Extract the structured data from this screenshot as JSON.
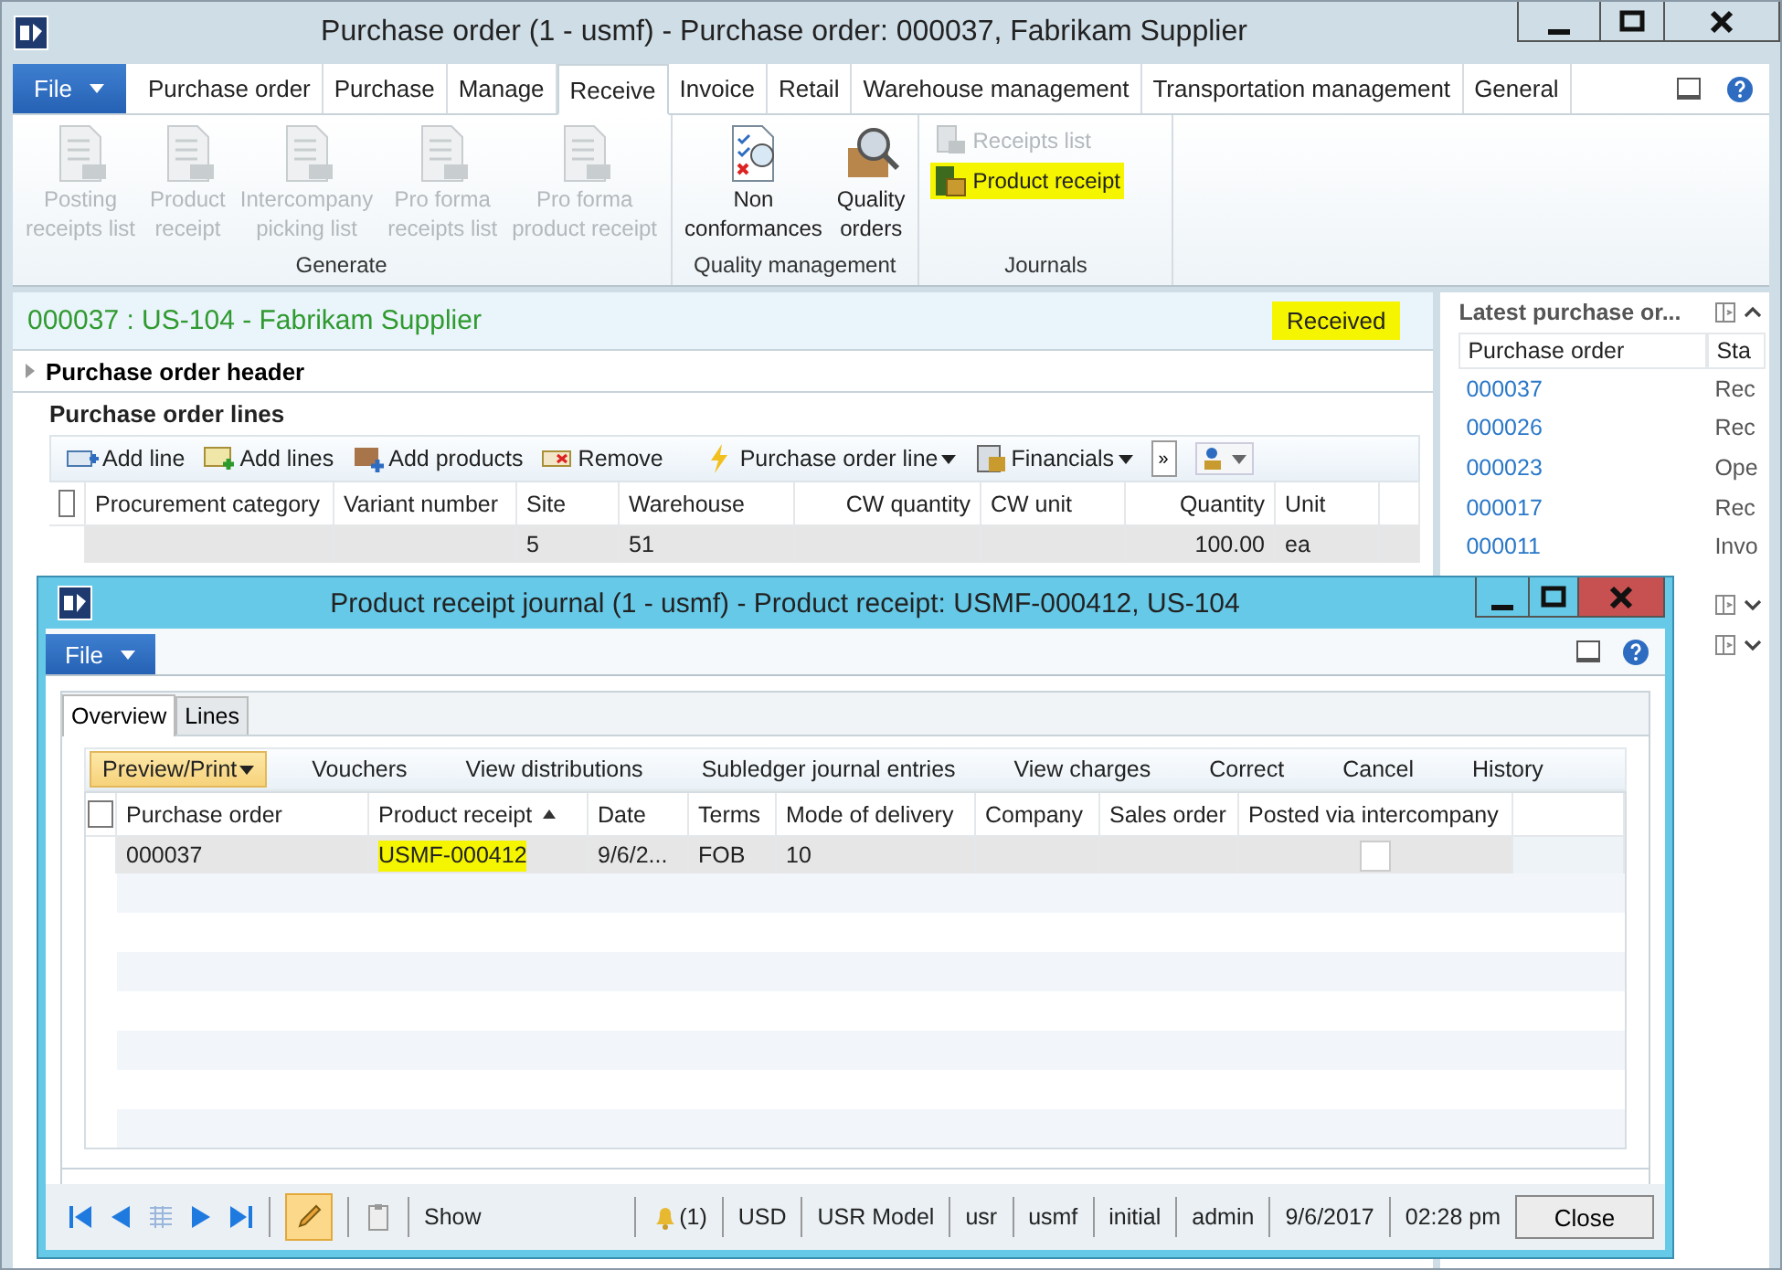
{
  "main_window": {
    "title": "Purchase order (1 - usmf) - Purchase order: 000037, Fabrikam Supplier",
    "file_menu": "File",
    "tabs": [
      {
        "label": "Purchase order",
        "selected": false
      },
      {
        "label": "Purchase",
        "selected": false
      },
      {
        "label": "Manage",
        "selected": false
      },
      {
        "label": "Receive",
        "selected": true
      },
      {
        "label": "Invoice",
        "selected": false
      },
      {
        "label": "Retail",
        "selected": false
      },
      {
        "label": "Warehouse management",
        "selected": false
      },
      {
        "label": "Transportation management",
        "selected": false
      },
      {
        "label": "General",
        "selected": false
      }
    ],
    "ribbon_groups": [
      {
        "title": "Generate",
        "kind": "large",
        "buttons": [
          {
            "label": "Posting\nreceipts list",
            "disabled": true,
            "highlighted": false
          },
          {
            "label": "Product\nreceipt",
            "disabled": true,
            "highlighted": false
          },
          {
            "label": "Intercompany\npicking list",
            "disabled": true,
            "highlighted": false
          },
          {
            "label": "Pro forma\nreceipts list",
            "disabled": true,
            "highlighted": false
          },
          {
            "label": "Pro forma\nproduct receipt",
            "disabled": true,
            "highlighted": false
          }
        ]
      },
      {
        "title": "Quality management",
        "kind": "large",
        "buttons": [
          {
            "label": "Non\nconformances",
            "disabled": false,
            "highlighted": false
          },
          {
            "label": "Quality\norders",
            "disabled": false,
            "highlighted": false
          }
        ]
      },
      {
        "title": "Journals",
        "kind": "small",
        "buttons": [
          {
            "label": "Receipts list",
            "disabled": true,
            "highlighted": false
          },
          {
            "label": "Product receipt",
            "disabled": false,
            "highlighted": true
          }
        ]
      }
    ],
    "header": {
      "title": "000037 : US-104 - Fabrikam Supplier",
      "status": "Received",
      "status_highlighted": true
    },
    "sections": [
      {
        "title": "Purchase order header",
        "expanded": false
      },
      {
        "title": "Purchase order lines",
        "expanded": true
      }
    ],
    "lines_toolbar": [
      {
        "label": "Add line",
        "menu": false
      },
      {
        "label": "Add lines",
        "menu": false
      },
      {
        "label": "Add products",
        "menu": false
      },
      {
        "label": "Remove",
        "menu": false
      },
      {
        "label": "Purchase order line",
        "menu": true
      },
      {
        "label": "Financials",
        "menu": true
      }
    ],
    "more_button": "»",
    "lines_table": {
      "all_selected": false,
      "columns": [
        "Procurement category",
        "Variant number",
        "Site",
        "Warehouse",
        "CW quantity",
        "CW unit",
        "Quantity",
        "Unit"
      ],
      "rows": [
        {
          "cells": [
            "",
            "",
            "5",
            "51",
            "",
            "",
            "100.00",
            "ea"
          ]
        }
      ]
    },
    "factbox": {
      "title": "Latest purchase or...",
      "expanded": true,
      "columns": [
        "Purchase order",
        "Sta"
      ],
      "rows": [
        [
          "000037",
          "Rec"
        ],
        [
          "000026",
          "Rec"
        ],
        [
          "000023",
          "Ope"
        ],
        [
          "000017",
          "Rec"
        ],
        [
          "000011",
          "Invo"
        ]
      ]
    }
  },
  "dialog": {
    "title": "Product receipt journal (1 - usmf) - Product receipt: USMF-000412, US-104",
    "file_menu": "File",
    "tabs": [
      {
        "label": "Overview",
        "selected": true
      },
      {
        "label": "Lines",
        "selected": false
      }
    ],
    "toolbar": [
      {
        "label": "Preview/Print",
        "menu": true,
        "active": true
      },
      {
        "label": "Vouchers",
        "menu": false,
        "active": false
      },
      {
        "label": "View distributions",
        "menu": false,
        "active": false
      },
      {
        "label": "Subledger journal entries",
        "menu": false,
        "active": false
      },
      {
        "label": "View charges",
        "menu": false,
        "active": false
      },
      {
        "label": "Correct",
        "menu": false,
        "active": false
      },
      {
        "label": "Cancel",
        "menu": false,
        "active": false
      },
      {
        "label": "History",
        "menu": false,
        "active": false
      }
    ],
    "table": {
      "all_selected": false,
      "columns": [
        {
          "label": "Purchase order",
          "sorted": false
        },
        {
          "label": "Product receipt",
          "sorted": true
        },
        {
          "label": "Date",
          "sorted": false
        },
        {
          "label": "Terms",
          "sorted": false
        },
        {
          "label": "Mode of delivery",
          "sorted": false
        },
        {
          "label": "Company",
          "sorted": false
        },
        {
          "label": "Sales order",
          "sorted": false
        },
        {
          "label": "Posted via intercompany",
          "sorted": false
        }
      ],
      "rows": [
        {
          "cells": [
            {
              "text": "000037",
              "highlighted": false
            },
            {
              "text": "USMF-000412",
              "highlighted": true
            },
            {
              "text": "9/6/2...",
              "highlighted": false
            },
            {
              "text": "FOB",
              "highlighted": false
            },
            {
              "text": "10",
              "highlighted": false
            },
            {
              "text": "",
              "highlighted": false
            },
            {
              "text": "",
              "highlighted": false
            }
          ],
          "posted_via_intercompany": false
        }
      ]
    },
    "status_bar": {
      "edit_mode": true,
      "show": "Show",
      "notifications": "(1)",
      "fields": [
        "USD",
        "USR Model",
        "usr",
        "usmf",
        "initial",
        "admin",
        "9/6/2017",
        "02:28 pm"
      ],
      "close": "Close"
    }
  }
}
